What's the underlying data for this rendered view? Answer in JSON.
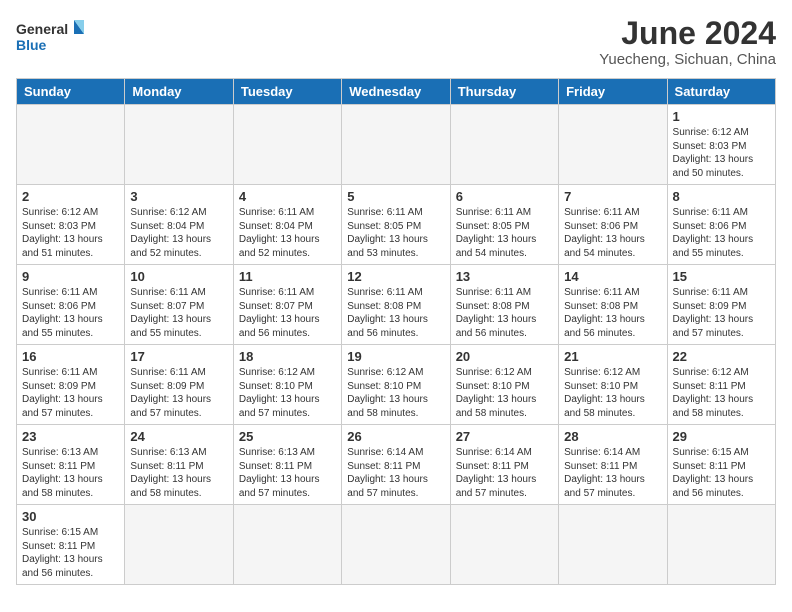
{
  "logo": {
    "line1": "General",
    "line2": "Blue"
  },
  "title": "June 2024",
  "subtitle": "Yuecheng, Sichuan, China",
  "weekdays": [
    "Sunday",
    "Monday",
    "Tuesday",
    "Wednesday",
    "Thursday",
    "Friday",
    "Saturday"
  ],
  "weeks": [
    [
      {
        "day": "",
        "info": ""
      },
      {
        "day": "",
        "info": ""
      },
      {
        "day": "",
        "info": ""
      },
      {
        "day": "",
        "info": ""
      },
      {
        "day": "",
        "info": ""
      },
      {
        "day": "",
        "info": ""
      },
      {
        "day": "1",
        "info": "Sunrise: 6:12 AM\nSunset: 8:03 PM\nDaylight: 13 hours\nand 50 minutes."
      }
    ],
    [
      {
        "day": "2",
        "info": "Sunrise: 6:12 AM\nSunset: 8:03 PM\nDaylight: 13 hours\nand 51 minutes."
      },
      {
        "day": "3",
        "info": "Sunrise: 6:12 AM\nSunset: 8:04 PM\nDaylight: 13 hours\nand 52 minutes."
      },
      {
        "day": "4",
        "info": "Sunrise: 6:11 AM\nSunset: 8:04 PM\nDaylight: 13 hours\nand 52 minutes."
      },
      {
        "day": "5",
        "info": "Sunrise: 6:11 AM\nSunset: 8:05 PM\nDaylight: 13 hours\nand 53 minutes."
      },
      {
        "day": "6",
        "info": "Sunrise: 6:11 AM\nSunset: 8:05 PM\nDaylight: 13 hours\nand 54 minutes."
      },
      {
        "day": "7",
        "info": "Sunrise: 6:11 AM\nSunset: 8:06 PM\nDaylight: 13 hours\nand 54 minutes."
      },
      {
        "day": "8",
        "info": "Sunrise: 6:11 AM\nSunset: 8:06 PM\nDaylight: 13 hours\nand 55 minutes."
      }
    ],
    [
      {
        "day": "9",
        "info": "Sunrise: 6:11 AM\nSunset: 8:06 PM\nDaylight: 13 hours\nand 55 minutes."
      },
      {
        "day": "10",
        "info": "Sunrise: 6:11 AM\nSunset: 8:07 PM\nDaylight: 13 hours\nand 55 minutes."
      },
      {
        "day": "11",
        "info": "Sunrise: 6:11 AM\nSunset: 8:07 PM\nDaylight: 13 hours\nand 56 minutes."
      },
      {
        "day": "12",
        "info": "Sunrise: 6:11 AM\nSunset: 8:08 PM\nDaylight: 13 hours\nand 56 minutes."
      },
      {
        "day": "13",
        "info": "Sunrise: 6:11 AM\nSunset: 8:08 PM\nDaylight: 13 hours\nand 56 minutes."
      },
      {
        "day": "14",
        "info": "Sunrise: 6:11 AM\nSunset: 8:08 PM\nDaylight: 13 hours\nand 56 minutes."
      },
      {
        "day": "15",
        "info": "Sunrise: 6:11 AM\nSunset: 8:09 PM\nDaylight: 13 hours\nand 57 minutes."
      }
    ],
    [
      {
        "day": "16",
        "info": "Sunrise: 6:11 AM\nSunset: 8:09 PM\nDaylight: 13 hours\nand 57 minutes."
      },
      {
        "day": "17",
        "info": "Sunrise: 6:11 AM\nSunset: 8:09 PM\nDaylight: 13 hours\nand 57 minutes."
      },
      {
        "day": "18",
        "info": "Sunrise: 6:12 AM\nSunset: 8:10 PM\nDaylight: 13 hours\nand 57 minutes."
      },
      {
        "day": "19",
        "info": "Sunrise: 6:12 AM\nSunset: 8:10 PM\nDaylight: 13 hours\nand 58 minutes."
      },
      {
        "day": "20",
        "info": "Sunrise: 6:12 AM\nSunset: 8:10 PM\nDaylight: 13 hours\nand 58 minutes."
      },
      {
        "day": "21",
        "info": "Sunrise: 6:12 AM\nSunset: 8:10 PM\nDaylight: 13 hours\nand 58 minutes."
      },
      {
        "day": "22",
        "info": "Sunrise: 6:12 AM\nSunset: 8:11 PM\nDaylight: 13 hours\nand 58 minutes."
      }
    ],
    [
      {
        "day": "23",
        "info": "Sunrise: 6:13 AM\nSunset: 8:11 PM\nDaylight: 13 hours\nand 58 minutes."
      },
      {
        "day": "24",
        "info": "Sunrise: 6:13 AM\nSunset: 8:11 PM\nDaylight: 13 hours\nand 58 minutes."
      },
      {
        "day": "25",
        "info": "Sunrise: 6:13 AM\nSunset: 8:11 PM\nDaylight: 13 hours\nand 57 minutes."
      },
      {
        "day": "26",
        "info": "Sunrise: 6:14 AM\nSunset: 8:11 PM\nDaylight: 13 hours\nand 57 minutes."
      },
      {
        "day": "27",
        "info": "Sunrise: 6:14 AM\nSunset: 8:11 PM\nDaylight: 13 hours\nand 57 minutes."
      },
      {
        "day": "28",
        "info": "Sunrise: 6:14 AM\nSunset: 8:11 PM\nDaylight: 13 hours\nand 57 minutes."
      },
      {
        "day": "29",
        "info": "Sunrise: 6:15 AM\nSunset: 8:11 PM\nDaylight: 13 hours\nand 56 minutes."
      }
    ],
    [
      {
        "day": "30",
        "info": "Sunrise: 6:15 AM\nSunset: 8:11 PM\nDaylight: 13 hours\nand 56 minutes."
      },
      {
        "day": "",
        "info": ""
      },
      {
        "day": "",
        "info": ""
      },
      {
        "day": "",
        "info": ""
      },
      {
        "day": "",
        "info": ""
      },
      {
        "day": "",
        "info": ""
      },
      {
        "day": "",
        "info": ""
      }
    ]
  ]
}
